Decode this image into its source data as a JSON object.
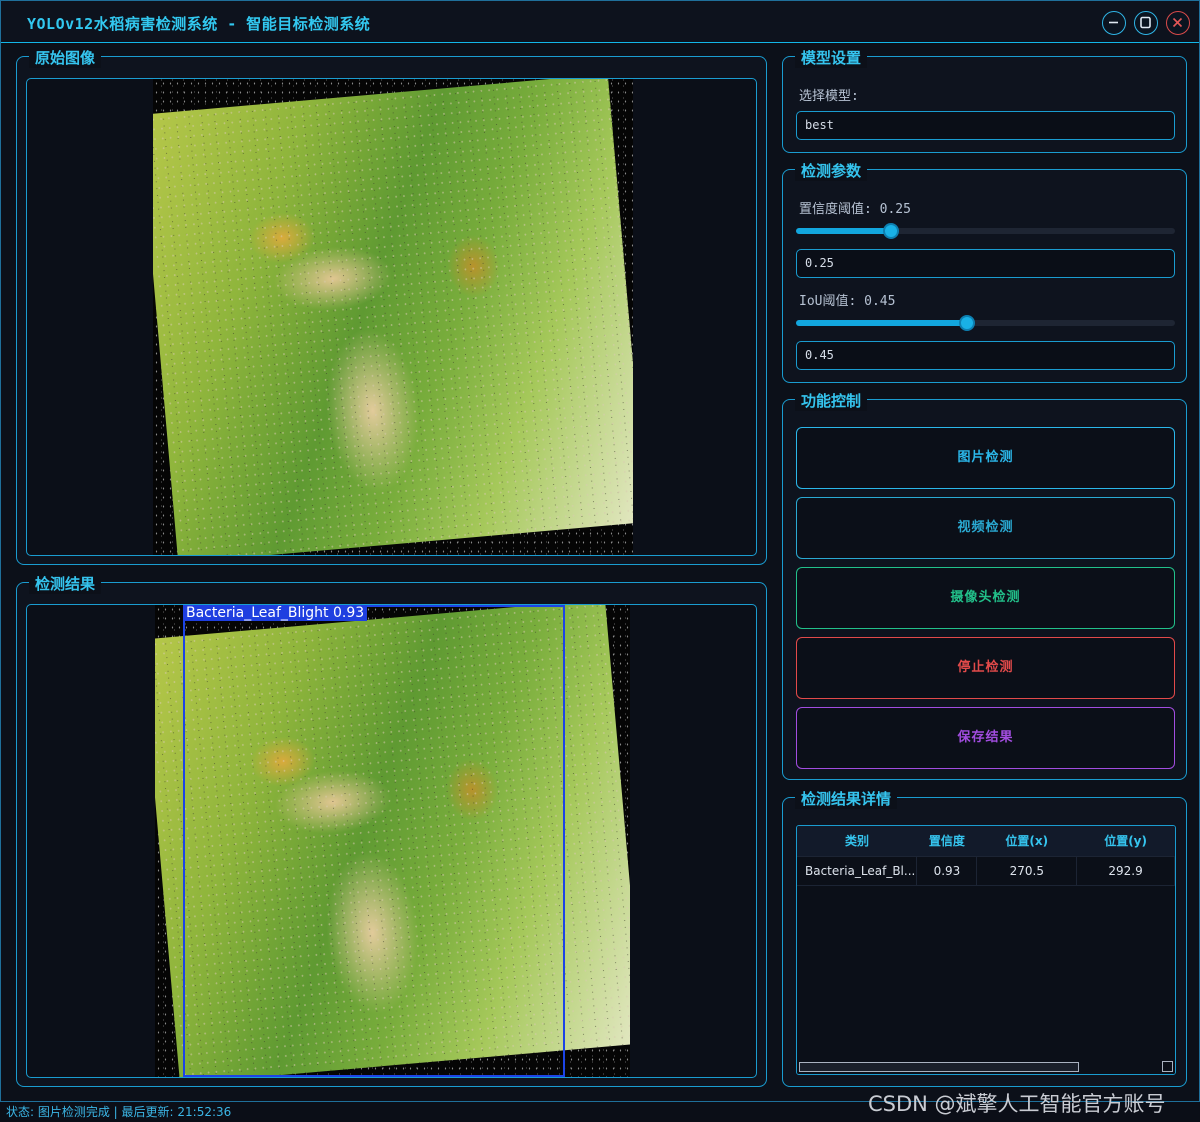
{
  "window": {
    "title": "YOLOv12水稻病害检测系统 - 智能目标检测系统",
    "controls": [
      "minimize-icon",
      "maximize-icon",
      "close-icon"
    ]
  },
  "original_panel": {
    "title": "原始图像"
  },
  "result_panel": {
    "title": "检测结果",
    "detection_label": "Bacteria_Leaf_Blight 0.93",
    "box_color": "#1c44e6"
  },
  "model_settings": {
    "title": "模型设置",
    "select_label": "选择模型:",
    "selected_model": "best"
  },
  "detection_params": {
    "title": "检测参数",
    "confidence_label": "置信度阈值: 0.25",
    "confidence_value": "0.25",
    "confidence_fraction": 0.25,
    "iou_label": "IoU阈值: 0.45",
    "iou_value": "0.45",
    "iou_fraction": 0.45
  },
  "function_controls": {
    "title": "功能控制",
    "buttons": [
      {
        "label": "图片检测",
        "color": "#2bb7ea"
      },
      {
        "label": "视频检测",
        "color": "#2aa9d2"
      },
      {
        "label": "摄像头检测",
        "color": "#22c08a"
      },
      {
        "label": "停止检测",
        "color": "#e24a4a"
      },
      {
        "label": "保存结果",
        "color": "#a24de0"
      }
    ]
  },
  "results_detail": {
    "title": "检测结果详情",
    "columns": [
      "类别",
      "置信度",
      "位置(x)",
      "位置(y)"
    ],
    "rows": [
      [
        "Bacteria_Leaf_Bl...",
        "0.93",
        "270.5",
        "292.9"
      ]
    ]
  },
  "status": {
    "text": "状态: 图片检测完成 | 最后更新: 21:52:36"
  },
  "watermark": "CSDN @斌擎人工智能官方账号"
}
